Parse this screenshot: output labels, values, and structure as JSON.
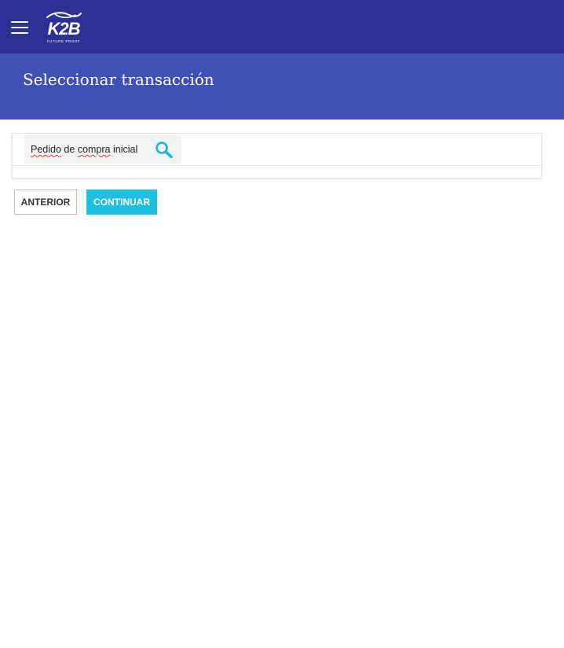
{
  "app": {
    "brand": "K2B",
    "brand_tagline": "FUTURE PROOF"
  },
  "page": {
    "title": "Seleccionar transacción"
  },
  "search": {
    "value_words": [
      "Pedido",
      "de",
      "compra",
      "inicial"
    ],
    "icon": "search-icon"
  },
  "actions": {
    "previous_label": "ANTERIOR",
    "continue_label": "CONTINUAR"
  },
  "icons": {
    "menu": "menu-icon",
    "search": "search-icon"
  },
  "colors": {
    "topbar": "#2c3193",
    "header": "#3f51b5",
    "accent": "#1ebfe0",
    "search_icon": "#19b6d9",
    "spellcheck_underline": "#d43b3b"
  }
}
